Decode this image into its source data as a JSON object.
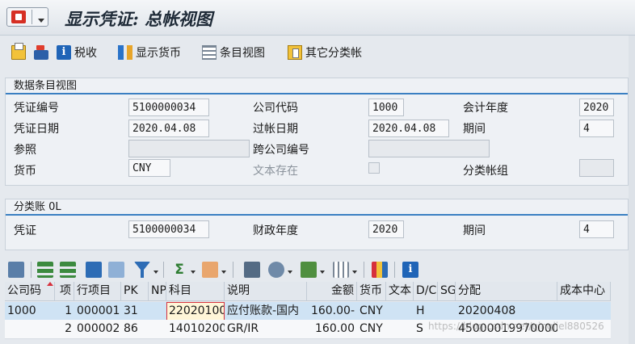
{
  "window": {
    "title": "显示凭证: 总帐视图"
  },
  "toolbar": {
    "tax_label": "税收",
    "currency_label": "显示货币",
    "entry_view_label": "条目视图",
    "other_ledger_label": "其它分类帐"
  },
  "entry_view": {
    "title": "数据条目视图",
    "doc_no_label": "凭证编号",
    "doc_no": "5100000034",
    "company_label": "公司代码",
    "company": "1000",
    "fiscal_year_label": "会计年度",
    "fiscal_year": "2020",
    "doc_date_label": "凭证日期",
    "doc_date": "2020.04.08",
    "posting_date_label": "过帐日期",
    "posting_date": "2020.04.08",
    "period_label": "期间",
    "period": "4",
    "reference_label": "参照",
    "reference": "",
    "cross_company_label": "跨公司编号",
    "cross_company": "",
    "currency_label": "货币",
    "currency": "CNY",
    "text_exists_label": "文本存在",
    "ledger_group_label": "分类帐组",
    "ledger_group": ""
  },
  "ledger": {
    "title": "分类账 0L",
    "doc_label": "凭证",
    "doc": "5100000034",
    "fiscal_year_label": "财政年度",
    "fiscal_year": "2020",
    "period_label": "期间",
    "period": "4"
  },
  "grid": {
    "columns": [
      "公司码",
      "项",
      "行项目",
      "PK",
      "NP",
      "科目",
      "说明",
      "金额",
      "货币",
      "文本",
      "D/C",
      "SG",
      "分配",
      "成本中心"
    ],
    "rows": [
      [
        "1000",
        "1",
        "000001",
        "31",
        "",
        "22020100",
        "应付账款-国内",
        "160.00-",
        "CNY",
        "",
        "H",
        "",
        "20200408",
        ""
      ],
      [
        "",
        "2",
        "000002",
        "86",
        "",
        "14010200",
        "GR/IR",
        "160.00",
        "CNY",
        "",
        "S",
        "",
        "4500001997000010",
        ""
      ]
    ]
  },
  "watermark": "https://blog.csdn.net/qingjiel880526"
}
